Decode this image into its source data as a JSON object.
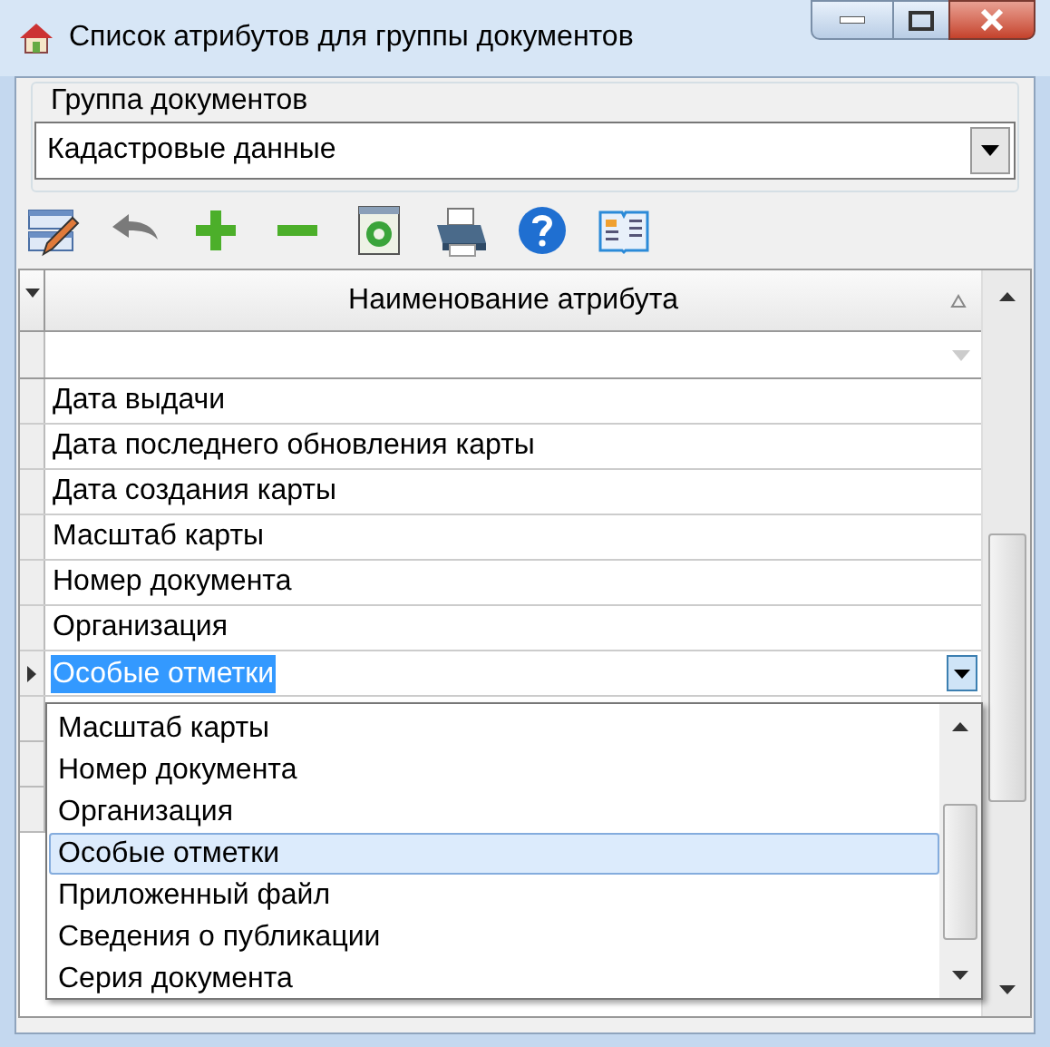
{
  "window": {
    "title": "Список атрибутов для группы документов"
  },
  "group": {
    "label": "Группа документов",
    "value": "Кадастровые данные"
  },
  "toolbar": [
    {
      "kind": "edit"
    },
    {
      "kind": "undo"
    },
    {
      "kind": "add"
    },
    {
      "kind": "remove"
    },
    {
      "kind": "refresh"
    },
    {
      "kind": "print"
    },
    {
      "kind": "help"
    },
    {
      "kind": "book"
    }
  ],
  "grid": {
    "columns": [
      "Наименование атрибута"
    ],
    "rows": [
      {
        "text": "Дата выдачи",
        "selected": false
      },
      {
        "text": "Дата последнего обновления карты",
        "selected": false
      },
      {
        "text": "Дата создания карты",
        "selected": false
      },
      {
        "text": "Масштаб карты",
        "selected": false
      },
      {
        "text": "Номер документа",
        "selected": false
      },
      {
        "text": "Организация",
        "selected": false
      },
      {
        "text": "Особые отметки",
        "selected": true
      }
    ]
  },
  "dropdown": {
    "items": [
      {
        "text": "Масштаб карты",
        "selected": false
      },
      {
        "text": "Номер документа",
        "selected": false
      },
      {
        "text": "Организация",
        "selected": false
      },
      {
        "text": "Особые отметки",
        "selected": true
      },
      {
        "text": "Приложенный файл",
        "selected": false
      },
      {
        "text": "Сведения о публикации",
        "selected": false
      },
      {
        "text": "Серия документа",
        "selected": false
      }
    ]
  }
}
